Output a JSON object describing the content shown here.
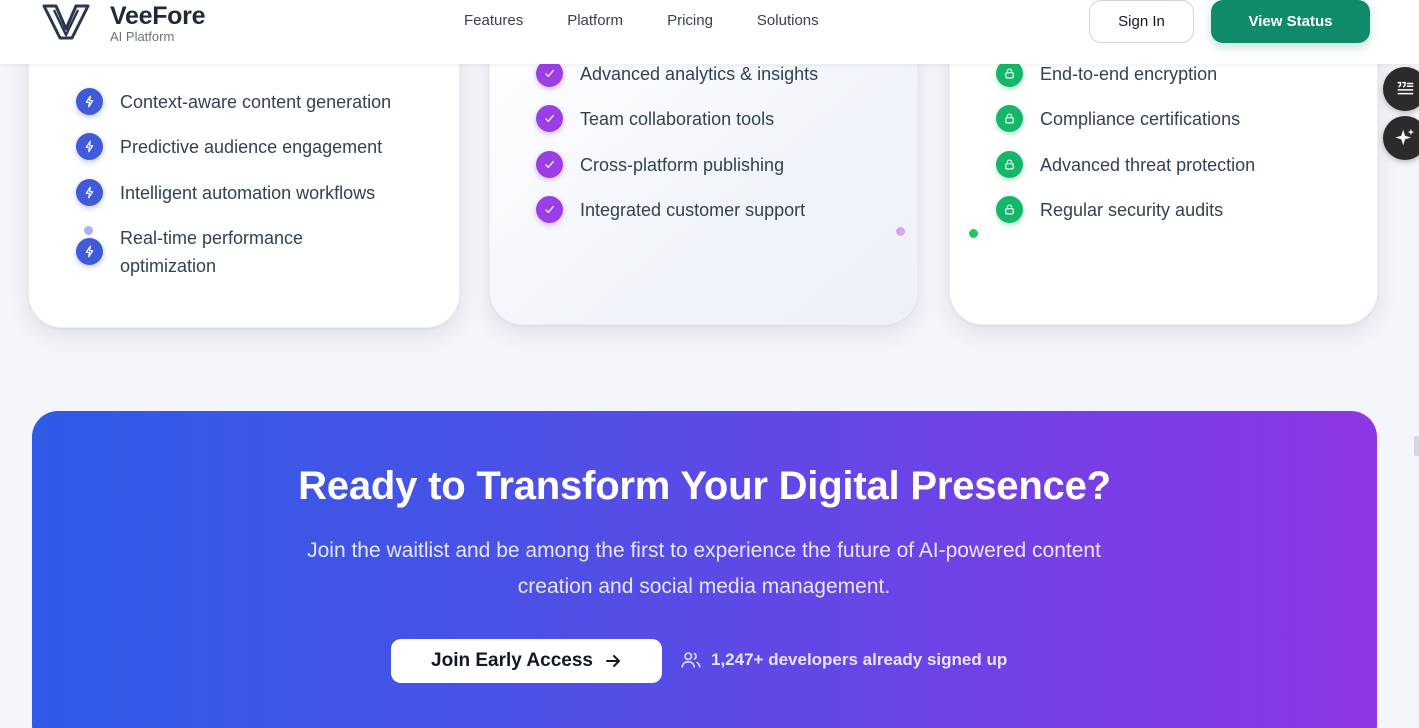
{
  "header": {
    "brand_name": "VeeFore",
    "brand_sub": "AI Platform",
    "nav": [
      "Features",
      "Platform",
      "Pricing",
      "Solutions"
    ],
    "signin_label": "Sign In",
    "status_label": "View Status"
  },
  "cards": {
    "ai": {
      "icon": "lightning-icon",
      "color": "#3f5bd9",
      "items": [
        "Context-aware content generation",
        "Predictive audience engagement",
        "Intelligent automation workflows",
        "Real-time performance",
        "optimization"
      ]
    },
    "platform": {
      "icon": "check-icon",
      "color": "#9b3ee6",
      "items": [
        "Advanced analytics & insights",
        "Team collaboration tools",
        "Cross-platform publishing",
        "Integrated customer support"
      ]
    },
    "security": {
      "icon": "lock-icon",
      "color": "#16b66a",
      "items": [
        "End-to-end encryption",
        "Compliance certifications",
        "Advanced threat protection",
        "Regular security audits"
      ]
    }
  },
  "side": {
    "top_icon": "quote-list-icon",
    "bottom_icon": "sparkle-icon"
  },
  "cta": {
    "title": "Ready to Transform Your Digital Presence?",
    "subtitle_line1": "Join the waitlist and be among the first to experience the future of AI-powered content",
    "subtitle_line2": "creation and social media management.",
    "button_label": "Join Early Access",
    "signed_up": "1,247+ developers already signed up",
    "gradient_start": "#2f5be6",
    "gradient_end": "#8e36e6"
  }
}
